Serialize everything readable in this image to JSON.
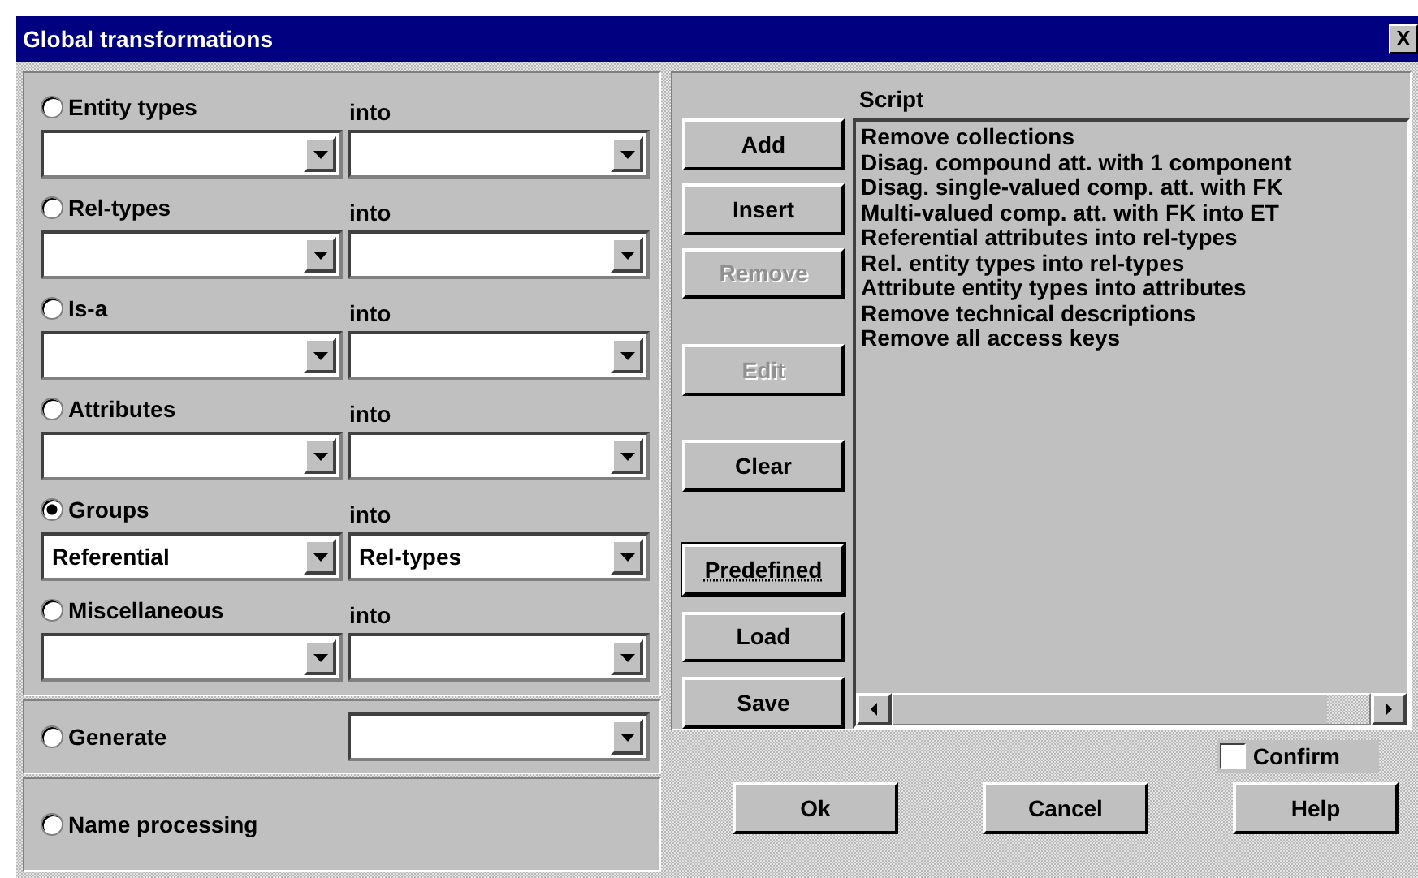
{
  "window": {
    "title": "Global transformations",
    "close_label": "X"
  },
  "transformations": [
    {
      "label": "Entity types",
      "selected": false,
      "into": "into"
    },
    {
      "label": "Rel-types",
      "selected": false,
      "into": "into"
    },
    {
      "label": "Is-a",
      "selected": false,
      "into": "into"
    },
    {
      "label": "Attributes",
      "selected": false,
      "into": "into"
    },
    {
      "label": "Groups",
      "selected": true,
      "into": "into",
      "source": "Referential",
      "target": "Rel-types"
    },
    {
      "label": "Miscellaneous",
      "selected": false,
      "into": "into"
    }
  ],
  "generate": {
    "label": "Generate",
    "selected": false
  },
  "name_processing": {
    "label": "Name processing",
    "selected": false
  },
  "script_buttons": [
    {
      "label": "Add",
      "disabled": false,
      "focused": false
    },
    {
      "label": "Insert",
      "disabled": false,
      "focused": false
    },
    {
      "label": "Remove",
      "disabled": true,
      "focused": false
    },
    {
      "label": "Edit",
      "disabled": true,
      "focused": false
    },
    {
      "label": "Clear",
      "disabled": false,
      "focused": false
    },
    {
      "label": "Predefined",
      "disabled": false,
      "focused": true
    },
    {
      "label": "Load",
      "disabled": false,
      "focused": false
    },
    {
      "label": "Save",
      "disabled": false,
      "focused": false
    }
  ],
  "script": {
    "title": "Script",
    "items": [
      "Remove collections",
      "Disag. compound att. with 1 component",
      "Disag. single-valued comp. att. with FK",
      "Multi-valued comp. att. with FK into ET",
      "Referential attributes into rel-types",
      "Rel. entity types into rel-types",
      "Attribute entity types into attributes",
      "Remove technical descriptions",
      "Remove all access keys"
    ]
  },
  "confirm": {
    "label": "Confirm",
    "checked": false
  },
  "footer_buttons": [
    "Ok",
    "Cancel",
    "Help"
  ]
}
